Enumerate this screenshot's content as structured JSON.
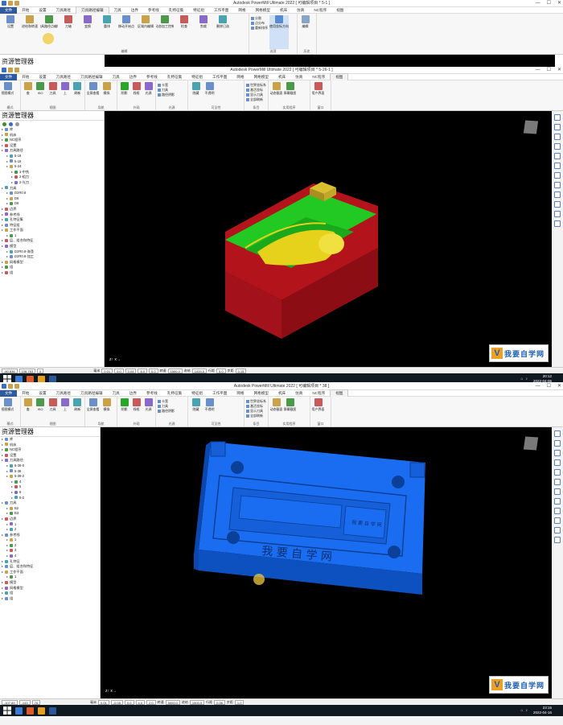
{
  "colors": {
    "accent": "#2d5aa0",
    "viewport": "#000000",
    "part_green": "#22c922",
    "part_red": "#b3141c",
    "part_yellow": "#e6d21a",
    "mold_blue": "#1a6df0"
  },
  "window1": {
    "title": "Autodesk PowerMill Ultimate 2022 [ 可编辑项目 * 5-1 ]",
    "tabs": [
      "文件",
      "开始",
      "设置",
      "刀具路径",
      "刀具路径编辑",
      "刀具",
      "边界",
      "参考线",
      "孔特征集",
      "特征组",
      "工作平面",
      "网格",
      "网格模型",
      "机床",
      "仿真",
      "NC程序",
      "视图"
    ],
    "active_tab": "刀具路径编辑",
    "ribbon_buttons": [
      "设置",
      "进给和转速",
      "刀具路径点编辑",
      "刀轴",
      "变换",
      "重排",
      "移动开始点",
      "区域内编辑",
      "动态加工控制",
      "检查",
      "剪裁",
      "删除已选"
    ],
    "ribbon_small": [
      "分割",
      "点分布",
      "重新排序"
    ],
    "ribbon_extra": [
      "使用坐标方向",
      "编辑"
    ],
    "group_labels": [
      "编辑",
      "选项",
      "历史"
    ]
  },
  "window2": {
    "title": "Autodesk PowerMill Ultimate 2022 [ 可编辑项目 * 5-26-1 ]",
    "tabs": [
      "文件",
      "开始",
      "设置",
      "刀具路径",
      "刀具路径编辑",
      "刀具",
      "边界",
      "参考线",
      "孔特征集",
      "特征组",
      "工作平面",
      "网格",
      "网格模型",
      "机床",
      "仿真",
      "NC程序",
      "视图"
    ],
    "active_tab": "视图",
    "ribbon_buttons": [
      "视图模式",
      "查",
      "ISO",
      "刀具",
      "上",
      "刷新",
      "全屏查看",
      "模拟",
      "阴影",
      "线框",
      "光源",
      "隐藏",
      "不透明",
      "动态截面",
      "屏幕截图",
      "用户界面"
    ],
    "ribbon_small": [
      "卡宽",
      "刀具",
      "路径阴影",
      "世界坐标系",
      "激活坐标",
      "显示刀具",
      "全部刷新"
    ],
    "group_labels": [
      "模式",
      "视图",
      "导航",
      "外观",
      "光源",
      "可见性",
      "条目",
      "实用程序",
      "窗口"
    ],
    "explorer_title": "资源管理器",
    "tree": [
      "库",
      "机床",
      "NC程序",
      "设置",
      "刀具路径",
      "5-18",
      "5-19",
      "5-24",
      "1-中铣",
      "2-粗刀",
      "2-光刀",
      "刀具",
      "D2R0.8",
      "D6",
      "D8",
      "边界",
      "参考线",
      "孔特征集",
      "特征组",
      "工作平面",
      "1",
      "层、组合和特征",
      "模型",
      "D2R0.8-海藻",
      "D2R0.8-加工",
      "网格模型",
      "组",
      "组"
    ],
    "status": {
      "x": "-60.836",
      "y": "108.763",
      "z": "0",
      "unit": "毫米",
      "tol": "0.01",
      "stock": "0.0",
      "step1": "0.04",
      "step2": "8.0",
      "thick": "0.0",
      "speed": "1500.0",
      "feed": "1000.0",
      "row": "5.0",
      "step": "0.15"
    },
    "clock": {
      "time": "20:12",
      "date": "2022-04-06"
    }
  },
  "window3": {
    "title": "Autodesk PowerMill Ultimate 2022 [ 可编辑项目 * 38 ]",
    "tabs": [
      "文件",
      "开始",
      "设置",
      "刀具路径",
      "刀具路径编辑",
      "刀具",
      "边界",
      "参考线",
      "孔特征集",
      "特征组",
      "工作平面",
      "网格",
      "网格模型",
      "机床",
      "仿真",
      "NC程序",
      "视图"
    ],
    "active_tab": "视图",
    "ribbon_buttons": [
      "视图模式",
      "查",
      "ISO",
      "刀具",
      "上",
      "刷新",
      "全屏查看",
      "模拟",
      "阴影",
      "线框",
      "光源",
      "隐藏",
      "不透明",
      "动态截面",
      "屏幕截图",
      "用户界面"
    ],
    "ribbon_small": [
      "卡宽",
      "刀具",
      "路径阴影",
      "世界坐标系",
      "激活坐标",
      "显示刀具",
      "全部刷新"
    ],
    "group_labels": [
      "模式",
      "视图",
      "导航",
      "外观",
      "光源",
      "可见性",
      "条目",
      "实用程序",
      "窗口"
    ],
    "explorer_title": "资源管理器",
    "tree": [
      "库",
      "机床",
      "NC程序",
      "设置",
      "刀具路径",
      "5-38-0",
      "5-38",
      "5-39-2",
      "4",
      "5",
      "6",
      "5-2",
      "刀具",
      "B2",
      "B3",
      "边界",
      "1",
      "2",
      "参考线",
      "1",
      "2",
      "3",
      "4",
      "孔特征",
      "层、组合和特征",
      "工作平面",
      "1",
      "模型",
      "网格模型",
      "组",
      "组"
    ],
    "status": {
      "x": "-107.89",
      "y": "-143",
      "z": "70",
      "unit": "毫米",
      "tol": "0.01",
      "stock": "-0.05",
      "step1": "0.0",
      "step2": "4.0",
      "thick": "2.0",
      "speed": "5000.0",
      "feed": "1500.0",
      "row": "0.06",
      "step": "1.0"
    },
    "clock": {
      "time": "23:15",
      "date": "2022-04-16"
    },
    "engraving": "我 要 自 学 网",
    "engraving_small": "我 要 自 学 网"
  },
  "logo_text": "我要自学网",
  "logo_sub": "www.51zxw.net",
  "status_labels": {
    "unit": "毫米",
    "speed": "转速",
    "feed": "进给",
    "row": "行距",
    "step": "步距"
  }
}
